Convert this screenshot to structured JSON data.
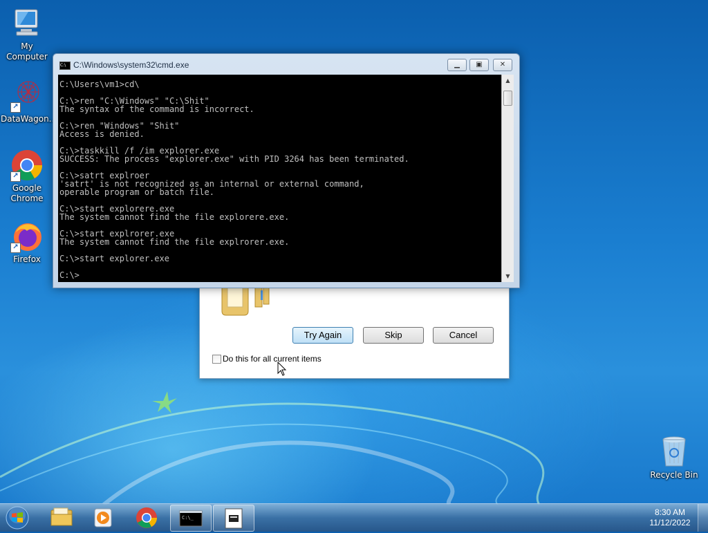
{
  "desktop": {
    "icons": [
      {
        "label": "My Computer",
        "icon": "computer-icon"
      },
      {
        "label": "DataWagon...",
        "icon": "datawagon-icon"
      },
      {
        "label": "Google Chrome",
        "icon": "chrome-icon"
      },
      {
        "label": "Firefox",
        "icon": "firefox-icon"
      },
      {
        "label": "Recycle Bin",
        "icon": "recycle-bin-icon"
      }
    ]
  },
  "cmd_window": {
    "title": "C:\\Windows\\system32\\cmd.exe",
    "minimize_glyph": "▁",
    "maximize_glyph": "▣",
    "close_glyph": "✕",
    "console_text": "C:\\Users\\vm1>cd\\\n\nC:\\>ren \"C:\\Windows\" \"C:\\Shit\"\nThe syntax of the command is incorrect.\n\nC:\\>ren \"Windows\" \"Shit\"\nAccess is denied.\n\nC:\\>taskkill /f /im explorer.exe\nSUCCESS: The process \"explorer.exe\" with PID 3264 has been terminated.\n\nC:\\>satrt explroer\n'satrt' is not recognized as an internal or external command,\noperable program or batch file.\n\nC:\\>start explorere.exe\nThe system cannot find the file explorere.exe.\n\nC:\\>start explrorer.exe\nThe system cannot find the file explrorer.exe.\n\nC:\\>start explorer.exe\n\nC:\\>"
  },
  "file_dialog": {
    "try_again_label": "Try Again",
    "skip_label": "Skip",
    "cancel_label": "Cancel",
    "checkbox_label": "Do this for all current items",
    "checkbox_checked": false
  },
  "taskbar": {
    "time": "8:30 AM",
    "date": "11/12/2022",
    "pinned": [
      "windows-explorer-icon",
      "media-player-icon",
      "chrome-icon",
      "cmd-icon",
      "application-icon"
    ]
  },
  "colors": {
    "console_bg": "#000000",
    "console_fg": "#c0c0c0",
    "desktop_blue": "#1a7ed0"
  }
}
